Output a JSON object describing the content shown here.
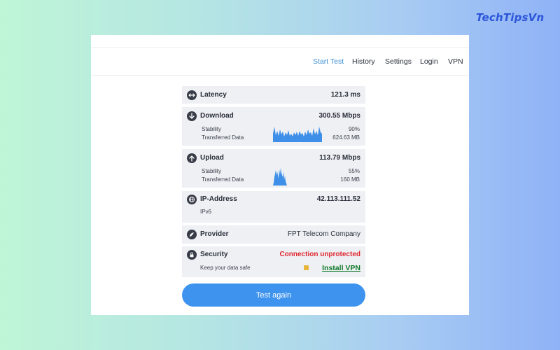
{
  "brand": "TechTipsVn",
  "nav": {
    "items": [
      {
        "label": "Start Test",
        "active": true
      },
      {
        "label": "History",
        "active": false
      },
      {
        "label": "Settings",
        "active": false
      },
      {
        "label": "Login",
        "active": false
      },
      {
        "label": "VPN",
        "active": false
      }
    ]
  },
  "latency": {
    "label": "Latency",
    "value": "121.3 ms",
    "icon": "arrows-horizontal-icon"
  },
  "download": {
    "label": "Download",
    "value": "300.55 Mbps",
    "icon": "arrow-down-icon",
    "stability_label": "Stability",
    "stability_value": "90%",
    "transferred_label": "Transferred Data",
    "transferred_value": "624.63 MB"
  },
  "upload": {
    "label": "Upload",
    "value": "113.79 Mbps",
    "icon": "arrow-up-icon",
    "stability_label": "Stability",
    "stability_value": "55%",
    "transferred_label": "Transferred Data",
    "transferred_value": "160 MB"
  },
  "ip": {
    "label": "IP-Address",
    "value": "42.113.111.52",
    "version": "IPv6",
    "icon": "globe-icon"
  },
  "provider": {
    "label": "Provider",
    "value": "FPT Telecom Company",
    "icon": "provider-icon"
  },
  "security": {
    "label": "Security",
    "value": "Connection unprotected",
    "icon": "lock-icon",
    "sub": "Keep your data safe",
    "action": "Install VPN"
  },
  "actions": {
    "test_again": "Test again"
  },
  "colors": {
    "accent": "#3d93ee",
    "nav_active": "#3f8fd6",
    "graph": "#3d8fe8",
    "danger": "#e0262f",
    "vpn_link": "#117a2a",
    "card_bg": "#eef0f4"
  }
}
